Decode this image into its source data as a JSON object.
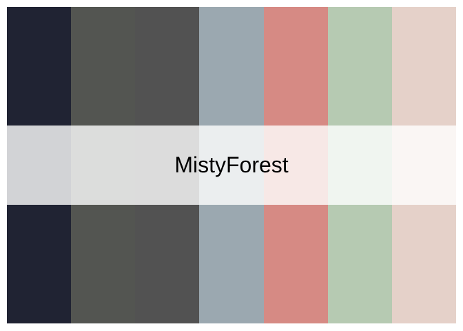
{
  "palette": {
    "name": "MistyForest",
    "colors": [
      "#202333",
      "#535551",
      "#525252",
      "#9BA8B0",
      "#D68A84",
      "#B6CAB2",
      "#E5D1C9"
    ]
  }
}
